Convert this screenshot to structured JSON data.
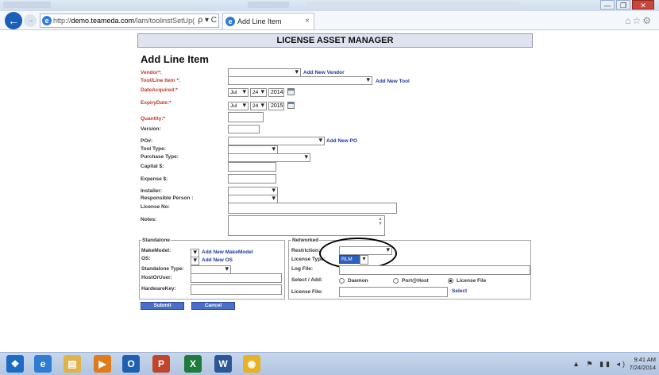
{
  "browser": {
    "url": "http://demo.teameda.com/lam/toolinstSetUp/",
    "url_host": "demo.teameda.com",
    "url_pre": "http://",
    "url_post": "/lam/toolinstSetUp(",
    "address_controls": "ρ ▾ C",
    "tab_title": "Add Line Item",
    "tab_close": "×",
    "window_buttons": {
      "minimize": "—",
      "maximize": "❐",
      "close": "✕"
    },
    "toolbar_icons": "⌂☆⚙"
  },
  "app": {
    "header": "LICENSE ASSET MANAGER",
    "page_title": "Add Line Item"
  },
  "form": {
    "vendor_label": "Vendor*:",
    "add_vendor": "Add New Vendor",
    "tool_label": "Tool/Line Item *:",
    "add_tool": "Add New Tool",
    "date_acquired_label": "DateAcquired:*",
    "date_acquired": {
      "month": "Jul",
      "day": "24",
      "year": "2014"
    },
    "expiry_label": "ExpiryDate:*",
    "expiry": {
      "month": "Jul",
      "day": "24",
      "year": "2015"
    },
    "quantity_label": "Quantity:*",
    "version_label": "Version:",
    "po_label": "PO#:",
    "add_po": "Add New PO",
    "tool_type_label": "Tool Type:",
    "purchase_type_label": "Purchase Type:",
    "capital_label": "Capital $:",
    "expense_label": "Expense $:",
    "installer_label": "Installer:",
    "responsible_label": "Responsible Person :",
    "license_no_label": "License No:",
    "notes_label": "Notes:"
  },
  "standalone": {
    "legend": "Standalone",
    "makemodel_label": "MakeModel:",
    "add_makemodel": "Add New MakeModel",
    "os_label": "OS:",
    "add_os": "Add New OS",
    "type_label": "Standalone Type:",
    "host_label": "HostOrUser:",
    "hardware_label": "HardwareKey:"
  },
  "networked": {
    "legend": "Networked",
    "restriction_label": "Restriction:",
    "license_type_label": "License Type:",
    "license_type_value": "RLM",
    "log_file_label": "Log File:",
    "select_add_label": "Select / Add:",
    "radios": [
      {
        "label": "Daemon",
        "checked": false
      },
      {
        "label": "Port@Host",
        "checked": false
      },
      {
        "label": "License File",
        "checked": true
      }
    ],
    "license_file_label": "License File:",
    "select_link": "Select"
  },
  "buttons": {
    "submit": "Submit",
    "cancel": "Cancel"
  },
  "taskbar": {
    "apps": [
      {
        "name": "start-button",
        "color": "#1e6bc4",
        "glyph": "❖"
      },
      {
        "name": "ie",
        "color": "#2f7cd3",
        "glyph": "e"
      },
      {
        "name": "explorer",
        "color": "#e0b24a",
        "glyph": "▤"
      },
      {
        "name": "media-player",
        "color": "#e07b1c",
        "glyph": "▶"
      },
      {
        "name": "outlook",
        "color": "#1f5fb0",
        "glyph": "O"
      },
      {
        "name": "powerpoint",
        "color": "#c0452b",
        "glyph": "P"
      },
      {
        "name": "excel",
        "color": "#1f7a3c",
        "glyph": "X"
      },
      {
        "name": "word",
        "color": "#2b5797",
        "glyph": "W"
      },
      {
        "name": "chrome",
        "color": "#e8b224",
        "glyph": "◉"
      }
    ],
    "tray": "▲ ⚑ ▮▮ ◂)",
    "time": "9:41 AM",
    "date": "7/24/2014"
  }
}
